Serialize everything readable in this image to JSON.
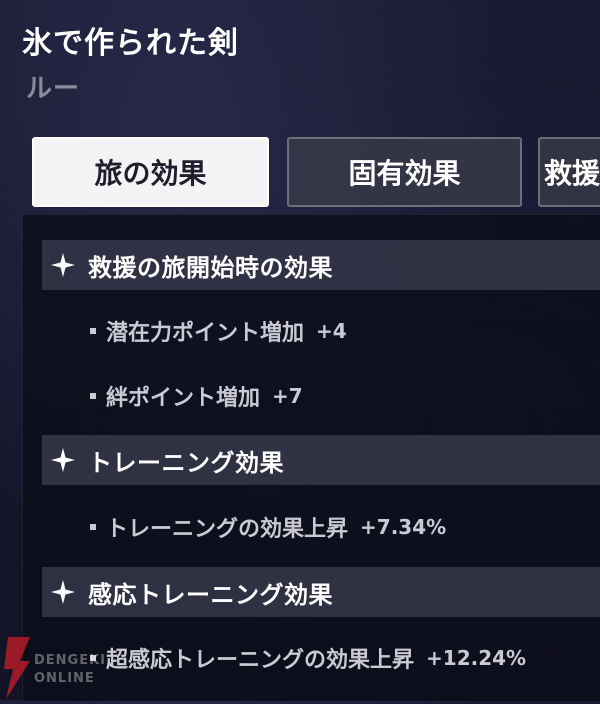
{
  "header": {
    "title": "氷で作られた剣",
    "subtitle": "ルー"
  },
  "tabs": [
    {
      "label": "旅の効果",
      "active": true
    },
    {
      "label": "固有効果",
      "active": false
    },
    {
      "label": "救援",
      "active": false
    }
  ],
  "sections": [
    {
      "title": "救援の旅開始時の効果",
      "icon": "sparkle-icon",
      "items": [
        {
          "label": "潜在力ポイント増加",
          "value": "+4"
        },
        {
          "label": "絆ポイント増加",
          "value": "+7"
        }
      ]
    },
    {
      "title": "トレーニング効果",
      "icon": "sparkle-icon",
      "items": [
        {
          "label": "トレーニングの効果上昇",
          "value": "+7.34%"
        }
      ]
    },
    {
      "title": "感応トレーニング効果",
      "icon": "sparkle-icon",
      "items": [
        {
          "label": "超感応トレーニングの効果上昇",
          "value": "+12.24%"
        }
      ]
    }
  ],
  "watermark": {
    "line1": "DENGEKI",
    "line2": "ONLINE"
  },
  "colors": {
    "background": "#15162a",
    "active_tab": "#f4f4f6",
    "inactive_tab": "#373846",
    "section_header": "#3a3b4e",
    "muted_text": "#8b8c9a"
  }
}
